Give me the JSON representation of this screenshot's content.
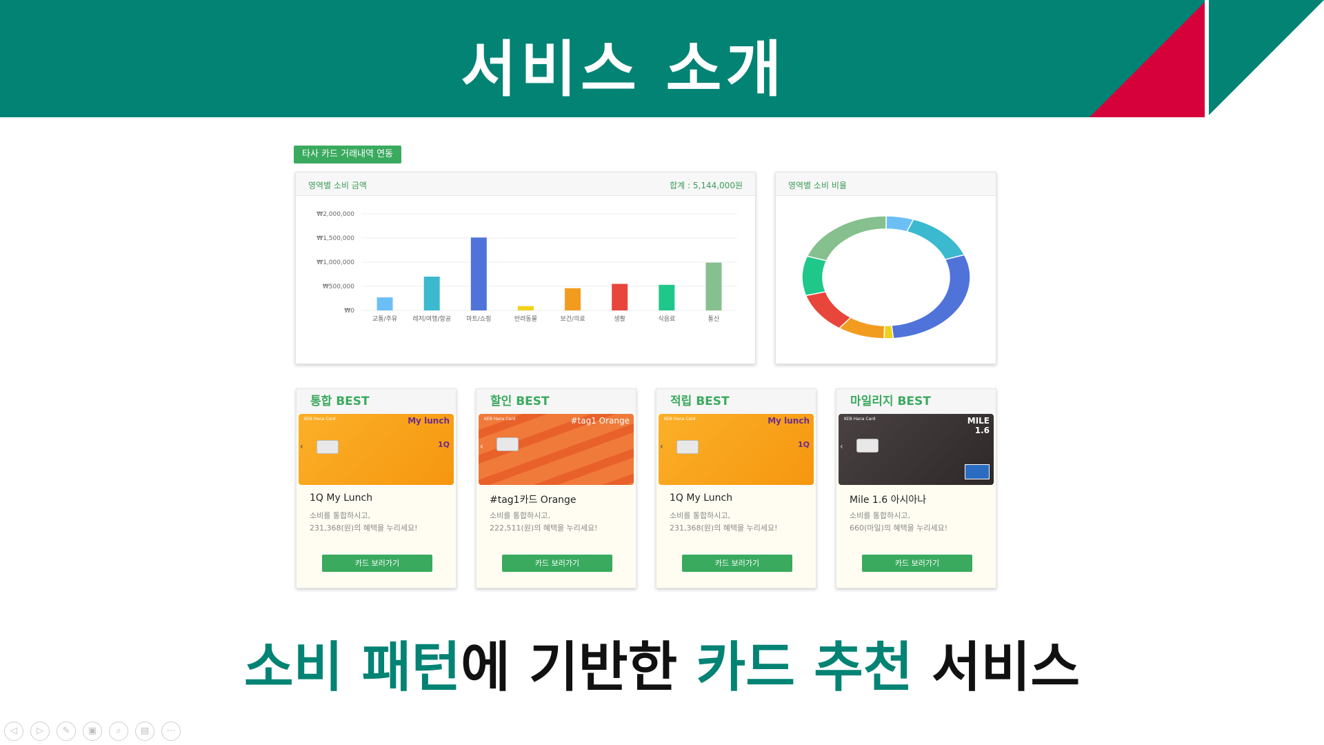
{
  "header": {
    "title": "서비스 소개",
    "colors": {
      "band": "#028374",
      "red": "#d6003b"
    }
  },
  "tag_label": "타사 카드 거래내역 연동",
  "bar_panel": {
    "title": "영역별 소비 금액",
    "total": "합계 : 5,144,000원"
  },
  "donut_panel": {
    "title": "영역별 소비 비율"
  },
  "chart_data": [
    {
      "type": "bar",
      "categories": [
        "교통/주유",
        "레저/여행/항공",
        "마트/쇼핑",
        "반려동물",
        "보건/의료",
        "생활",
        "식음료",
        "통신"
      ],
      "values": [
        270000,
        700000,
        1510000,
        90000,
        460000,
        550000,
        530000,
        990000
      ],
      "colors": [
        "#6cbff5",
        "#3bb9cf",
        "#4f73d9",
        "#f0d21c",
        "#f29c1f",
        "#e8463a",
        "#1fc78a",
        "#85c08e"
      ],
      "yticks": [
        "₩0",
        "₩500,000",
        "₩1,000,000",
        "₩1,500,000",
        "₩2,000,000"
      ],
      "ylim": [
        0,
        2000000
      ],
      "grid": true
    },
    {
      "type": "pie",
      "categories": [
        "교통/주유",
        "레저/여행/항공",
        "마트/쇼핑",
        "반려동물",
        "보건/의료",
        "생활",
        "식음료",
        "통신"
      ],
      "values": [
        270000,
        700000,
        1510000,
        90000,
        460000,
        550000,
        530000,
        990000
      ],
      "colors": [
        "#6cbff5",
        "#3bb9cf",
        "#4f73d9",
        "#f0d21c",
        "#f29c1f",
        "#e8463a",
        "#1fc78a",
        "#85c08e"
      ],
      "donut": true
    }
  ],
  "tiles": [
    {
      "heading": "통합 BEST",
      "card_name": "1Q My Lunch",
      "desc1": "소비를 통합하시고,",
      "desc2": "231,368(원)의 혜택을 누리세요!",
      "button": "카드 보러가기",
      "brand": "KEB Hana Card",
      "logo": "My lunch",
      "card_color": "#f9a11b"
    },
    {
      "heading": "할인 BEST",
      "card_name": "#tag1카드 Orange",
      "desc1": "소비를 통합하시고,",
      "desc2": "222,511(원)의 혜택을 누리세요!",
      "button": "카드 보러가기",
      "brand": "KEB Hana Card",
      "logo": "#tag1 Orange",
      "card_color": "#ee6a2f"
    },
    {
      "heading": "적립 BEST",
      "card_name": "1Q My Lunch",
      "desc1": "소비를 통합하시고,",
      "desc2": "231,368(원)의 혜택을 누리세요!",
      "button": "카드 보러가기",
      "brand": "KEB Hana Card",
      "logo": "My lunch",
      "card_color": "#f9a11b"
    },
    {
      "heading": "마일리지 BEST",
      "card_name": "Mile 1.6 아시아나",
      "desc1": "소비를 통합하시고,",
      "desc2": "660(마일)의 혜택을 누리세요!",
      "button": "카드 보러가기",
      "brand": "KEB Hana Card",
      "logo": "MILE 1.6",
      "card_color": "#3b3434"
    }
  ],
  "bottom_title": {
    "part1": "소비 패턴",
    "part2": "에 기반한 ",
    "part3": "카드 추천",
    "part4": " 서비스"
  },
  "toolbar_icons": [
    "prev-icon",
    "next-icon",
    "pen-icon",
    "slides-icon",
    "zoom-icon",
    "subtitle-icon",
    "more-icon"
  ]
}
